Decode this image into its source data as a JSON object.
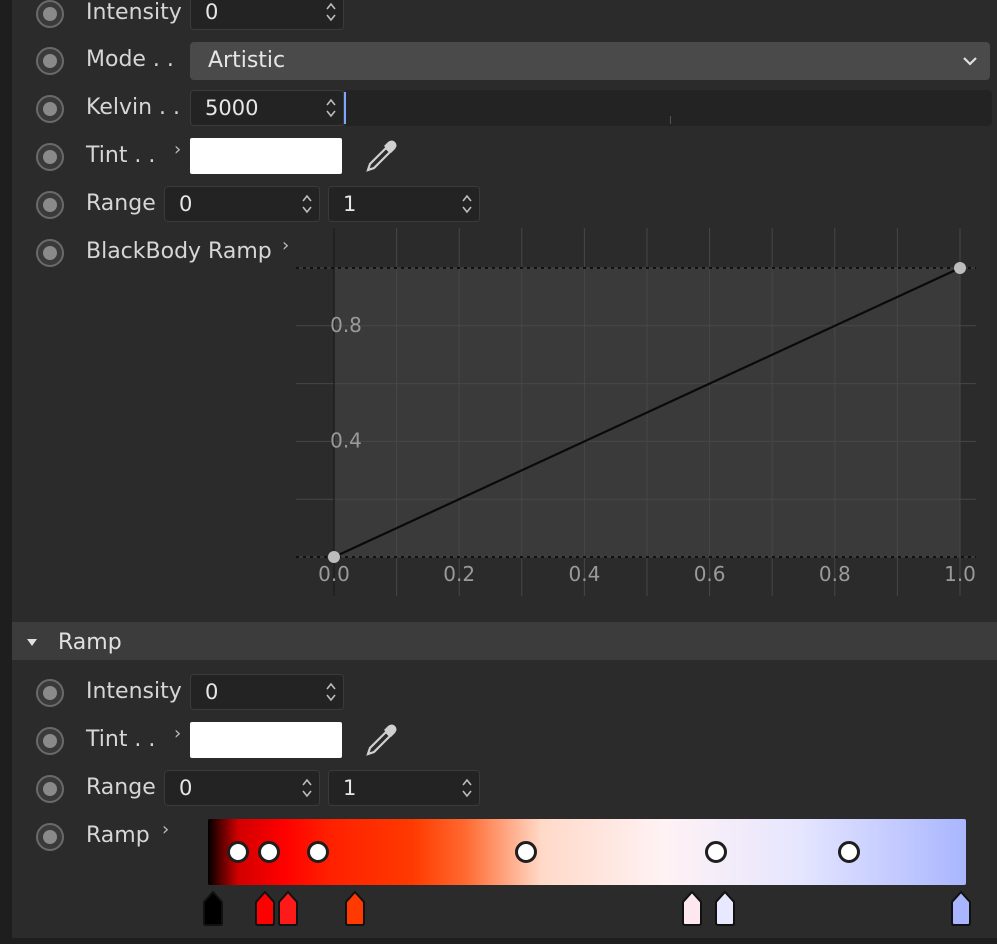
{
  "attenuation": {
    "intensity_label": "Intensity",
    "intensity_value": "0",
    "mode_label": "Mode . .",
    "mode_value": "Artistic",
    "kelvin_label": "Kelvin . .",
    "kelvin_value": "5000",
    "tint_label": "Tint  . .",
    "range_label": "Range",
    "range_min": "0",
    "range_max": "1",
    "blackbody_label": "BlackBody Ramp"
  },
  "chart_data": {
    "type": "line",
    "x": [
      0.0,
      1.0
    ],
    "y": [
      0.0,
      1.0
    ],
    "xticks": [
      "0.0",
      "0.2",
      "0.4",
      "0.6",
      "0.8",
      "1.0"
    ],
    "yticks": [
      "0.4",
      "0.8"
    ],
    "xlim": [
      0,
      1
    ],
    "ylim": [
      0,
      1
    ],
    "grid": true
  },
  "ramp_section": {
    "title": "Ramp",
    "intensity_label": "Intensity",
    "intensity_value": "0",
    "tint_label": "Tint  . .",
    "range_label": "Range",
    "range_min": "0",
    "range_max": "1",
    "ramp_label": "Ramp"
  },
  "gradient_ramp": {
    "knobs": [
      0.04,
      0.08,
      0.145,
      0.42,
      0.67,
      0.845
    ],
    "markers": [
      {
        "pos": 0.0,
        "color": "#000000"
      },
      {
        "pos": 0.07,
        "color": "#ff0000"
      },
      {
        "pos": 0.1,
        "color": "#ff1a1a"
      },
      {
        "pos": 0.19,
        "color": "#ff3a00"
      },
      {
        "pos": 0.64,
        "color": "#fde8ef"
      },
      {
        "pos": 0.685,
        "color": "#e8e8ff"
      },
      {
        "pos": 1.0,
        "color": "#a9b6ff"
      }
    ]
  },
  "colors": {
    "background": "#2b2b2b",
    "field": "#232323",
    "select": "#4a4a4a",
    "section": "#3c3c3c",
    "tint": "#ffffff"
  }
}
